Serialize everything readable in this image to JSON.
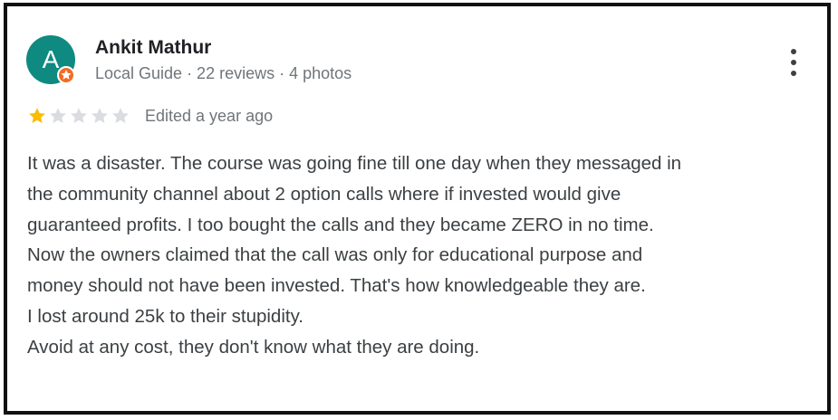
{
  "reviewer": {
    "avatar_initial": "A",
    "name": "Ankit Mathur",
    "meta": "Local Guide · 22 reviews · 4 photos",
    "badge_icon": "local-guide-star-icon",
    "avatar_color": "#0f8a80",
    "badge_color": "#f26b21"
  },
  "menu": {
    "icon": "more-vert-icon"
  },
  "rating": {
    "value": 1,
    "max": 5,
    "filled_color": "#fbbc04",
    "empty_color": "#dadce0",
    "edited_label": "Edited a year ago"
  },
  "review": {
    "lines": [
      "It was a disaster. The course was going fine till one day when they messaged in",
      "the community channel about 2 option calls where if invested would give",
      "guaranteed profits. I too bought the calls and they became ZERO in no time.",
      "Now the owners claimed that the call was only for educational purpose and",
      "money should not have been invested. That's how knowledgeable they are.",
      "I lost around 25k to their stupidity.",
      "Avoid at any cost, they don't know what they are doing."
    ]
  }
}
